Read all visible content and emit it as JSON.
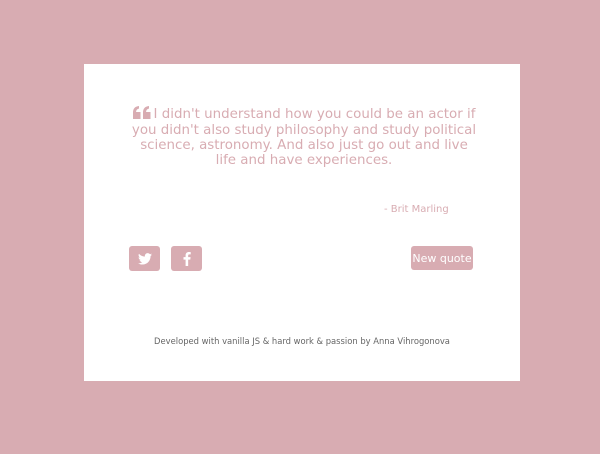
{
  "theme": {
    "background": "#d8acb2",
    "card_background": "#ffffff",
    "accent": "#d8acb2",
    "footer_text_color": "#666666"
  },
  "quote": {
    "icon": "quote-left-icon",
    "text": "I didn't understand how you could be an actor if you didn't also study philosophy and study political science, astronomy. And also just go out and live life and have experiences.",
    "author": "- Brit Marling"
  },
  "actions": {
    "twitter_icon": "twitter-icon",
    "facebook_icon": "facebook-icon",
    "new_quote_label": "New quote"
  },
  "footer": {
    "text": "Developed with vanilla JS & hard work & passion by Anna Vihrogonova"
  }
}
